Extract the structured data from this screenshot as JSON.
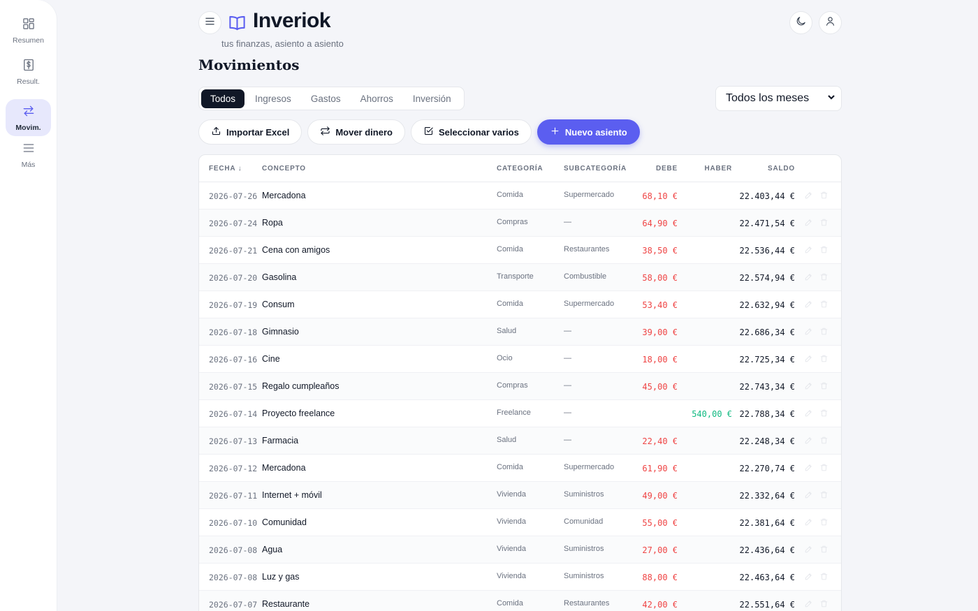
{
  "sidebar": {
    "items": [
      {
        "label": "Resumen",
        "icon": "dashboard-icon",
        "active": false
      },
      {
        "label": "Result.",
        "icon": "dollar-document-icon",
        "active": false
      },
      {
        "label": "Movim.",
        "icon": "transfer-arrows-icon",
        "active": true
      },
      {
        "label": "Más",
        "icon": "menu-lines-icon",
        "active": false
      }
    ]
  },
  "header": {
    "title": "Inveriok",
    "subtitle": "tus finanzas, asiento a asiento",
    "logo_icon": "open-book-icon",
    "theme_icon": "moon-icon",
    "user_icon": "user-icon"
  },
  "page": {
    "title": "Movimientos"
  },
  "tabs": [
    {
      "label": "Todos",
      "active": true
    },
    {
      "label": "Ingresos",
      "active": false
    },
    {
      "label": "Gastos",
      "active": false
    },
    {
      "label": "Ahorros",
      "active": false
    },
    {
      "label": "Inversión",
      "active": false
    }
  ],
  "month_filter": {
    "selected": "Todos los meses"
  },
  "actions": {
    "import_label": "Importar Excel",
    "move_label": "Mover dinero",
    "select_label": "Seleccionar varios",
    "new_label": "Nuevo asiento"
  },
  "table": {
    "headers": {
      "fecha": "FECHA ↓",
      "concepto": "CONCEPTO",
      "categoria": "CATEGORÍA",
      "subcategoria": "SUBCATEGORÍA",
      "debe": "DEBE",
      "haber": "HABER",
      "saldo": "SALDO"
    },
    "rows": [
      {
        "fecha": "2026-07-26",
        "concepto": "Mercadona",
        "categoria": "Comida",
        "subcategoria": "Supermercado",
        "debe": "68,10 €",
        "haber": "",
        "saldo": "22.403,44 €"
      },
      {
        "fecha": "2026-07-24",
        "concepto": "Ropa",
        "categoria": "Compras",
        "subcategoria": "—",
        "debe": "64,90 €",
        "haber": "",
        "saldo": "22.471,54 €"
      },
      {
        "fecha": "2026-07-21",
        "concepto": "Cena con amigos",
        "categoria": "Comida",
        "subcategoria": "Restaurantes",
        "debe": "38,50 €",
        "haber": "",
        "saldo": "22.536,44 €"
      },
      {
        "fecha": "2026-07-20",
        "concepto": "Gasolina",
        "categoria": "Transporte",
        "subcategoria": "Combustible",
        "debe": "58,00 €",
        "haber": "",
        "saldo": "22.574,94 €"
      },
      {
        "fecha": "2026-07-19",
        "concepto": "Consum",
        "categoria": "Comida",
        "subcategoria": "Supermercado",
        "debe": "53,40 €",
        "haber": "",
        "saldo": "22.632,94 €"
      },
      {
        "fecha": "2026-07-18",
        "concepto": "Gimnasio",
        "categoria": "Salud",
        "subcategoria": "—",
        "debe": "39,00 €",
        "haber": "",
        "saldo": "22.686,34 €"
      },
      {
        "fecha": "2026-07-16",
        "concepto": "Cine",
        "categoria": "Ocio",
        "subcategoria": "—",
        "debe": "18,00 €",
        "haber": "",
        "saldo": "22.725,34 €"
      },
      {
        "fecha": "2026-07-15",
        "concepto": "Regalo cumpleaños",
        "categoria": "Compras",
        "subcategoria": "—",
        "debe": "45,00 €",
        "haber": "",
        "saldo": "22.743,34 €"
      },
      {
        "fecha": "2026-07-14",
        "concepto": "Proyecto freelance",
        "categoria": "Freelance",
        "subcategoria": "—",
        "debe": "",
        "haber": "540,00 €",
        "saldo": "22.788,34 €"
      },
      {
        "fecha": "2026-07-13",
        "concepto": "Farmacia",
        "categoria": "Salud",
        "subcategoria": "—",
        "debe": "22,40 €",
        "haber": "",
        "saldo": "22.248,34 €"
      },
      {
        "fecha": "2026-07-12",
        "concepto": "Mercadona",
        "categoria": "Comida",
        "subcategoria": "Supermercado",
        "debe": "61,90 €",
        "haber": "",
        "saldo": "22.270,74 €"
      },
      {
        "fecha": "2026-07-11",
        "concepto": "Internet + móvil",
        "categoria": "Vivienda",
        "subcategoria": "Suministros",
        "debe": "49,00 €",
        "haber": "",
        "saldo": "22.332,64 €"
      },
      {
        "fecha": "2026-07-10",
        "concepto": "Comunidad",
        "categoria": "Vivienda",
        "subcategoria": "Comunidad",
        "debe": "55,00 €",
        "haber": "",
        "saldo": "22.381,64 €"
      },
      {
        "fecha": "2026-07-08",
        "concepto": "Agua",
        "categoria": "Vivienda",
        "subcategoria": "Suministros",
        "debe": "27,00 €",
        "haber": "",
        "saldo": "22.436,64 €"
      },
      {
        "fecha": "2026-07-08",
        "concepto": "Luz y gas",
        "categoria": "Vivienda",
        "subcategoria": "Suministros",
        "debe": "88,00 €",
        "haber": "",
        "saldo": "22.463,64 €"
      },
      {
        "fecha": "2026-07-07",
        "concepto": "Restaurante",
        "categoria": "Comida",
        "subcategoria": "Restaurantes",
        "debe": "42,00 €",
        "haber": "",
        "saldo": "22.551,64 €"
      }
    ]
  },
  "colors": {
    "accent": "#5b5ef0",
    "debit": "#ef4444",
    "credit": "#10b981",
    "background": "#f4f5f9"
  }
}
